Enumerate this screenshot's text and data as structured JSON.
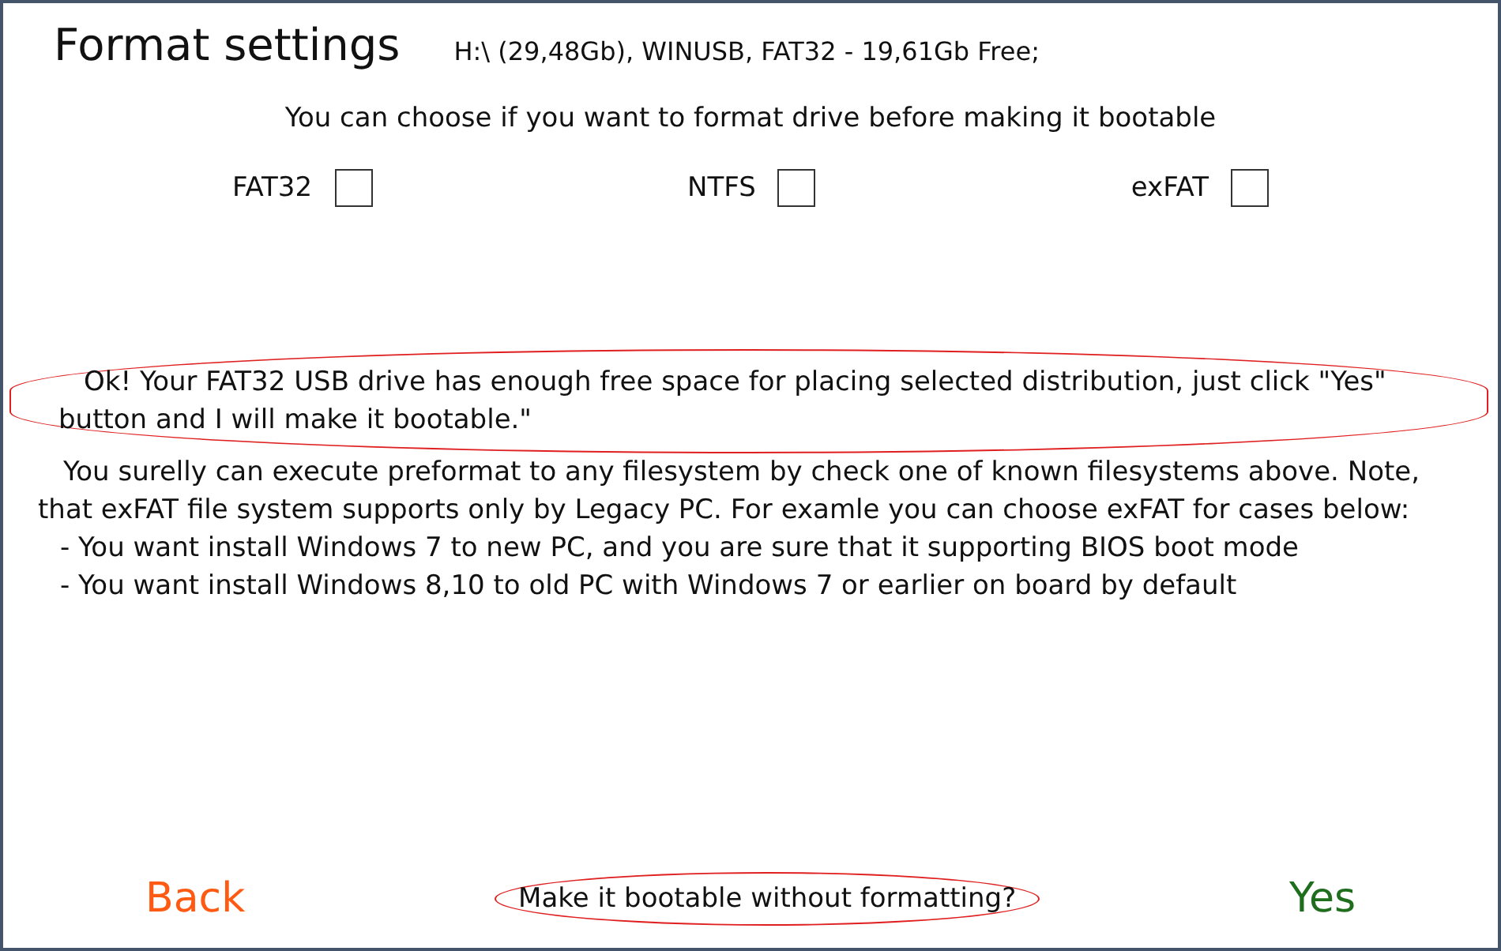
{
  "header": {
    "title": "Format settings",
    "drive_info": "H:\\ (29,48Gb), WINUSB, FAT32 - 19,61Gb Free;"
  },
  "prompt": "You can choose if you want to format drive before making it bootable",
  "filesystems": [
    {
      "label": "FAT32",
      "checked": false
    },
    {
      "label": "NTFS",
      "checked": false
    },
    {
      "label": "exFAT",
      "checked": false
    }
  ],
  "message": {
    "text": "Ok! Your FAT32 USB drive has enough free space for placing selected distribution, just click \"Yes\" button and I will make it bootable.\"",
    "highlighted": true
  },
  "note": "You surelly can execute preformat to any filesystem by check one of known filesystems above. Note, that exFAT file system supports only by Legacy PC. For examle you can choose exFAT for cases below:",
  "cases": [
    "- You want install Windows 7 to new PC, and you are sure that it supporting BIOS boot mode",
    "- You want install Windows 8,10 to old PC with Windows 7 or earlier on board by default"
  ],
  "buttons": [
    {
      "kind": "back",
      "label": "Back",
      "highlighted": false
    },
    {
      "kind": "skip",
      "label": "Make it bootable without formatting?",
      "highlighted": true
    },
    {
      "kind": "yes",
      "label": "Yes",
      "highlighted": false
    }
  ]
}
